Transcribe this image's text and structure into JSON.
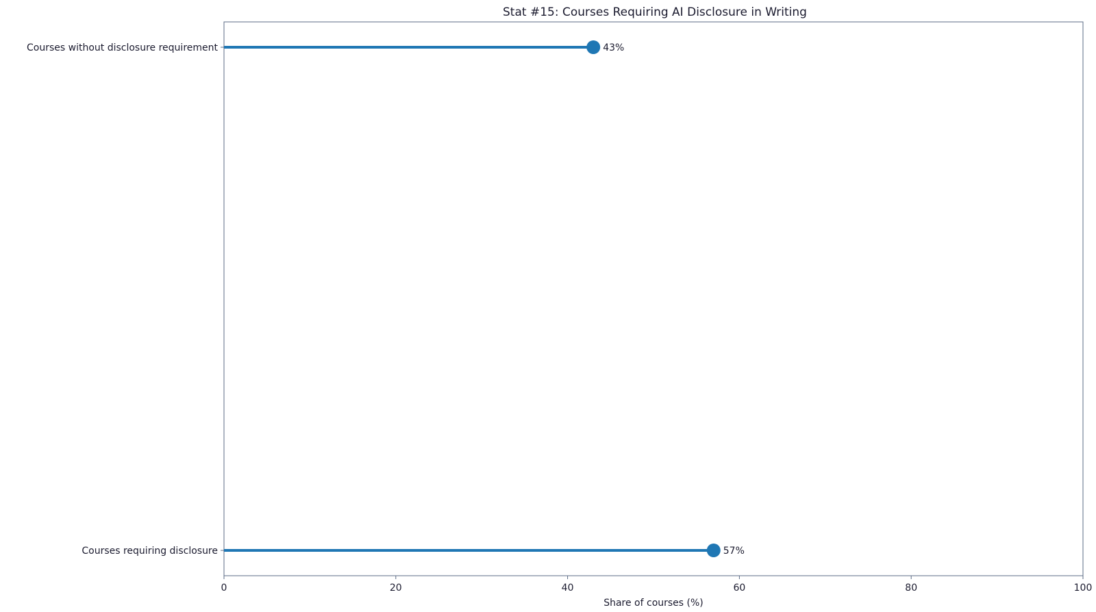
{
  "chart_data": {
    "type": "lollipop",
    "title": "Stat #15: Courses Requiring AI Disclosure in Writing",
    "xlabel": "Share of courses (%)",
    "ylabel": "",
    "xlim": [
      0,
      100
    ],
    "x_ticks": [
      0,
      20,
      40,
      60,
      80,
      100
    ],
    "categories": [
      "Courses requiring disclosure",
      "Courses without disclosure requirement"
    ],
    "values": [
      57,
      43
    ],
    "data_labels": [
      "57%",
      "43%"
    ],
    "grid": false,
    "legend": "none",
    "colors": {
      "series": "#1f77b4",
      "axes": "#5b6b85",
      "text": "#1a1a2e"
    }
  }
}
